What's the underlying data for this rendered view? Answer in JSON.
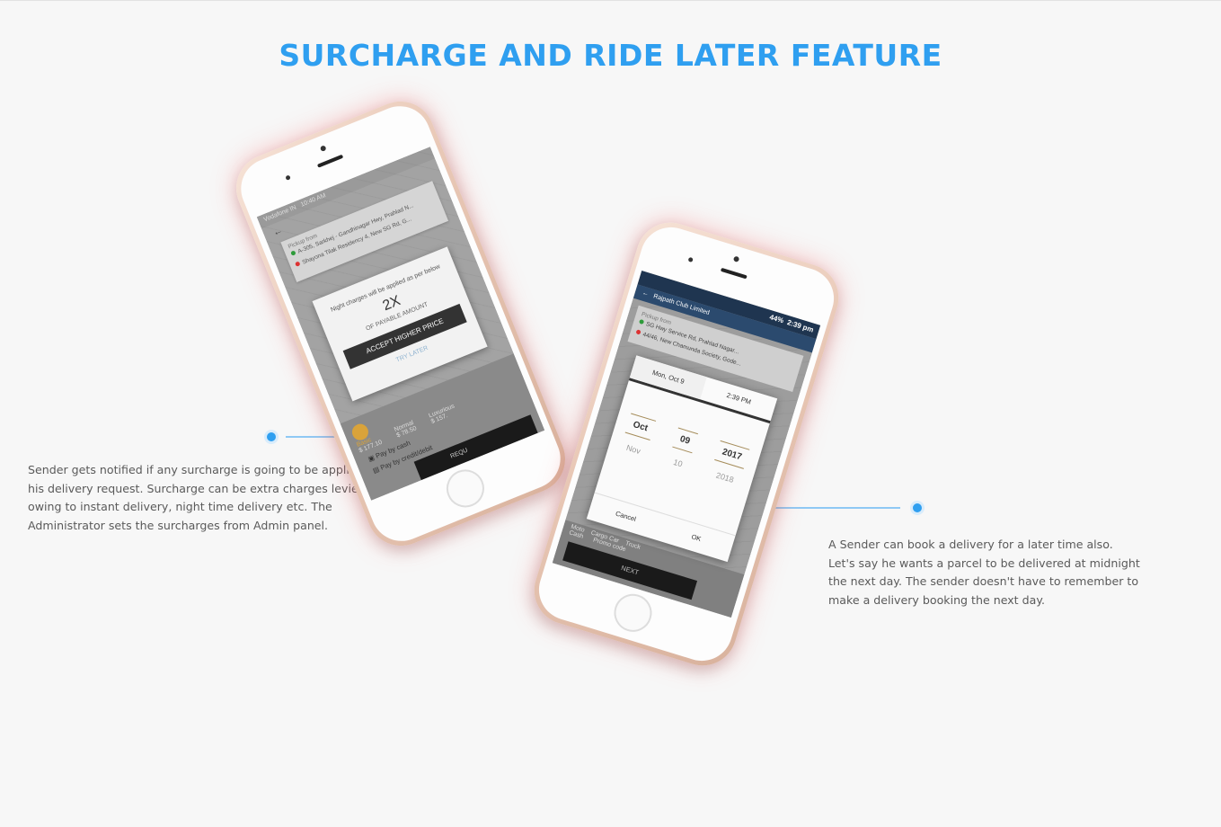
{
  "heading": "SURCHARGE AND RIDE LATER FEATURE",
  "left_description": "Sender gets notified if any surcharge is going to be applied on his delivery request. Surcharge can be extra charges levied owing to instant delivery, night time delivery etc. The Administrator sets the surcharges from Admin panel.",
  "right_description": "A Sender can book a delivery for a later time also. Let's say he wants a parcel to be delivered at midnight the next day. The sender doesn't have to remember to make a delivery booking the next day.",
  "accent_color": "#2f9ff0",
  "phone1": {
    "status_left": "Vodafone IN",
    "status_time": "10:40 AM",
    "pickup_label": "Pickup from",
    "pickup_address": "A-305, Sarkhej - Gandhinagar Hwy, Prahlad N...",
    "drop_address": "Shayona Tilak Residency 4, New SG Rd, G...",
    "modal_text": "Night charges will be applied as per below",
    "multiplier": "2X",
    "multiplier_sub": "OF PAYABLE AMOUNT",
    "accept_button": "ACCEPT HIGHER PRICE",
    "try_later": "TRY LATER",
    "option_basic": "Basic",
    "option_basic_price": "$ 177.10",
    "option_normal": "Normal",
    "option_normal_price": "$ 78.50",
    "option_luxurious": "Luxurious",
    "option_luxurious_price": "$ 157.",
    "pay_cash": "Pay by cash",
    "pay_card": "Pay by credit/debit",
    "request_button": "REQU"
  },
  "phone2": {
    "status_time": "2:39 pm",
    "status_battery": "44%",
    "app_location": "Rajpath Club Limited",
    "pickup_label": "Pickup from",
    "pickup_address": "SG Hwy Service Rd, Prahlad Nagar...",
    "drop_address": "44/46, New Chamunda Society, Gode...",
    "date_tab": "Mon, Oct 9",
    "time_tab": "2:39 PM",
    "month_selected": "Oct",
    "day_selected": "09",
    "year_selected": "2017",
    "month_next": "Nov",
    "day_next": "10",
    "year_next": "2018",
    "cancel_button": "Cancel",
    "ok_button": "OK",
    "veh_moto": "Moto",
    "veh_cargo": "Cargo Car",
    "veh_truck": "Truck",
    "pay_cash": "Cash",
    "promo": "Promo code",
    "next_button": "NEXT"
  }
}
